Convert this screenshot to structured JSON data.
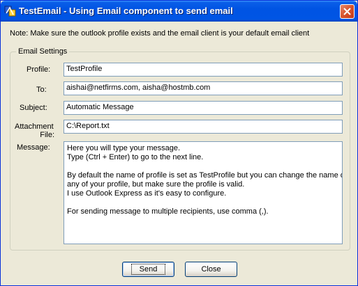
{
  "window": {
    "title": "TestEmail - Using Email component to send email",
    "icons": {
      "app": "app-icon",
      "close": "close-icon"
    }
  },
  "note": "Note: Make sure the outlook profile exists and the email client is your default email client",
  "group": {
    "label": "Email Settings",
    "profile": {
      "label": "Profile:",
      "value": "TestProfile"
    },
    "to": {
      "label": "To:",
      "value": "aishai@netfirms.com, aisha@hostmb.com"
    },
    "subject": {
      "label": "Subject:",
      "value": "Automatic Message"
    },
    "attachment": {
      "label_line1": "Attachment",
      "label_line2": "File:",
      "value": "C:\\Report.txt"
    },
    "message": {
      "label": "Message:",
      "lines": [
        "Here you will type your message.",
        "Type (Ctrl + Enter) to go to the next line.",
        "",
        "By default the name of profile is set as TestProfile but you can change the name of",
        "any of your profile, but make sure the profile is valid.",
        "I use Outlook Express as it's easy to configure.",
        "",
        "For sending message to multiple recipients, use comma (,)."
      ]
    }
  },
  "buttons": {
    "send": "Send",
    "close": "Close"
  },
  "colors": {
    "title_bar": "#0054e3",
    "close_button": "#d8542b",
    "dialog_bg": "#ece9d8",
    "field_border": "#7f9db9"
  }
}
